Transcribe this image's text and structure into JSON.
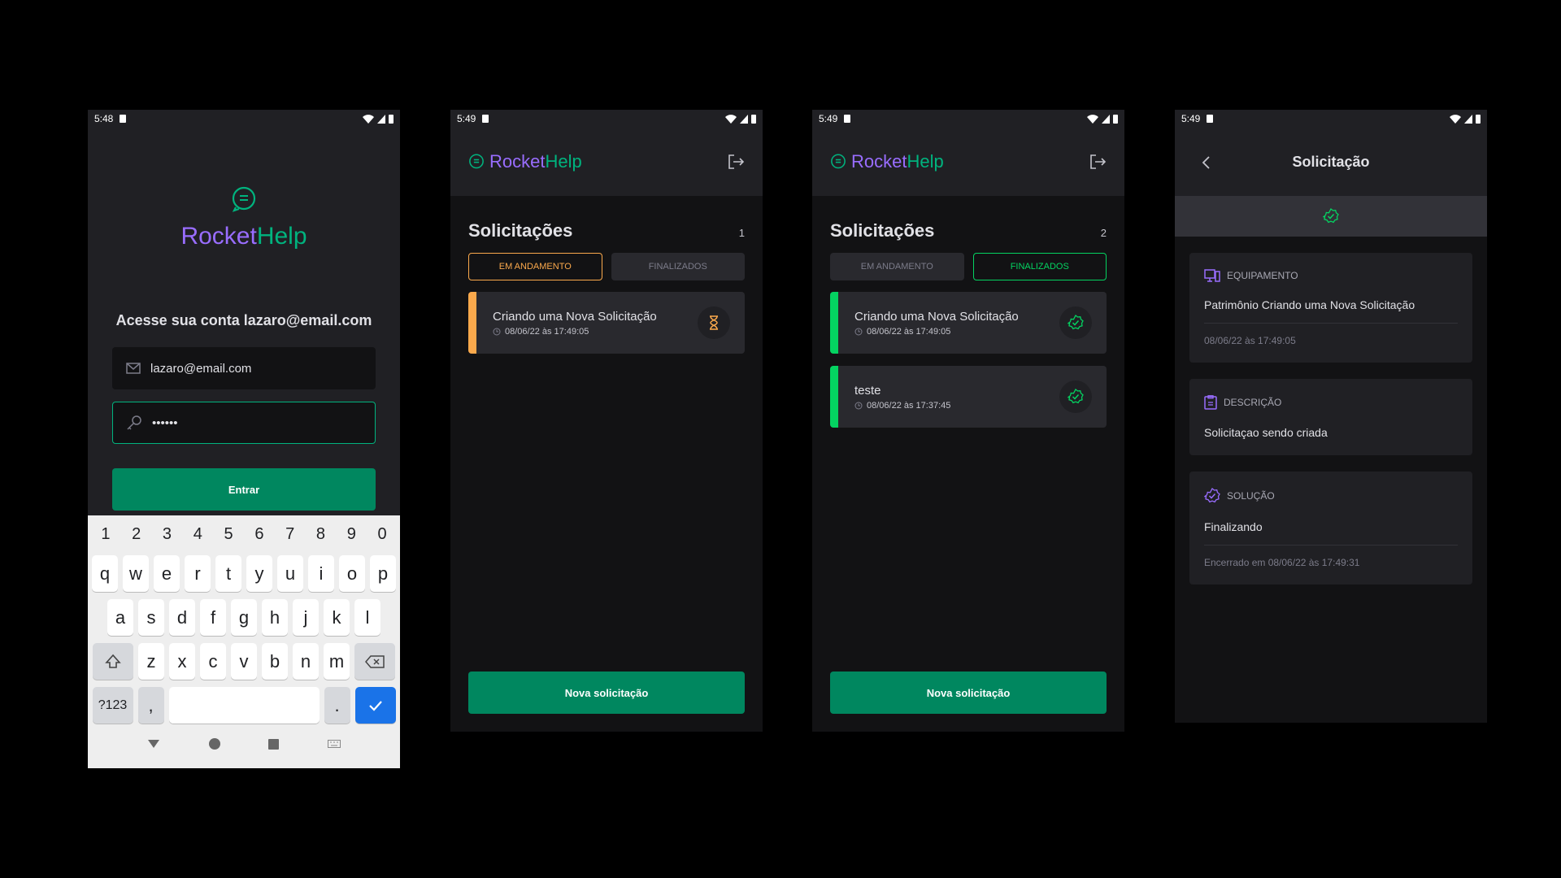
{
  "brand": {
    "rocket": "Rocket",
    "help": "Help"
  },
  "colors": {
    "purple": "#996dff",
    "green": "#00b37e",
    "orange": "#fba94c",
    "bright_green": "#04d361",
    "button": "#00875f"
  },
  "login": {
    "time": "5:48",
    "heading": "Acesse sua conta lazaro@email.com",
    "email_value": "lazaro@email.com",
    "password_value": "••••••",
    "submit_label": "Entrar",
    "keyboard": {
      "numbers": [
        "1",
        "2",
        "3",
        "4",
        "5",
        "6",
        "7",
        "8",
        "9",
        "0"
      ],
      "row1": [
        "q",
        "w",
        "e",
        "r",
        "t",
        "y",
        "u",
        "i",
        "o",
        "p"
      ],
      "row2": [
        "a",
        "s",
        "d",
        "f",
        "g",
        "h",
        "j",
        "k",
        "l"
      ],
      "row3": [
        "z",
        "x",
        "c",
        "v",
        "b",
        "n",
        "m"
      ],
      "sym_label": "?123",
      "comma": ",",
      "period": "."
    }
  },
  "list_open": {
    "time": "5:49",
    "title": "Solicitações",
    "count": "1",
    "filter_open": "EM ANDAMENTO",
    "filter_closed": "FINALIZADOS",
    "orders": [
      {
        "title": "Criando uma Nova Solicitação",
        "date": "08/06/22 às 17:49:05",
        "status": "open"
      }
    ],
    "new_label": "Nova solicitação"
  },
  "list_closed": {
    "time": "5:49",
    "title": "Solicitações",
    "count": "2",
    "filter_open": "EM ANDAMENTO",
    "filter_closed": "FINALIZADOS",
    "orders": [
      {
        "title": "Criando uma Nova Solicitação",
        "date": "08/06/22 às 17:49:05",
        "status": "closed"
      },
      {
        "title": "teste",
        "date": "08/06/22 às 17:37:45",
        "status": "closed"
      }
    ],
    "new_label": "Nova solicitação"
  },
  "detail": {
    "time": "5:49",
    "title": "Solicitação",
    "equipment_label": "EQUIPAMENTO",
    "equipment_text": "Patrimônio Criando uma Nova Solicitação",
    "equipment_date": "08/06/22 às 17:49:05",
    "description_label": "DESCRIÇÃO",
    "description_text": "Solicitaçao sendo criada",
    "solution_label": "SOLUÇÃO",
    "solution_text": "Finalizando",
    "solution_date": "Encerrado em 08/06/22 às 17:49:31"
  }
}
